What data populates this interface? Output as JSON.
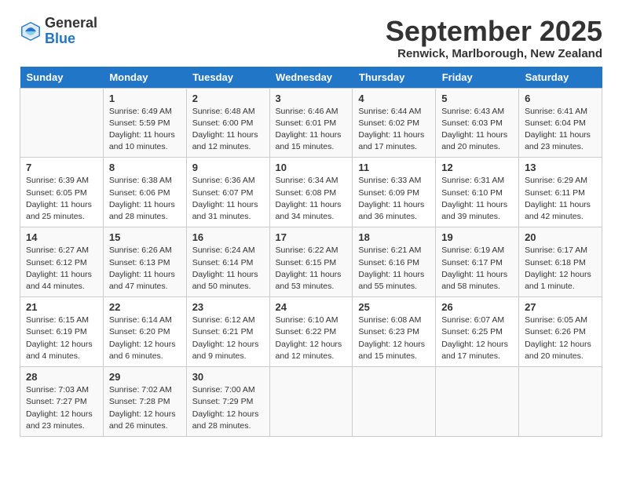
{
  "header": {
    "logo_general": "General",
    "logo_blue": "Blue",
    "month_year": "September 2025",
    "location": "Renwick, Marlborough, New Zealand"
  },
  "weekdays": [
    "Sunday",
    "Monday",
    "Tuesday",
    "Wednesday",
    "Thursday",
    "Friday",
    "Saturday"
  ],
  "weeks": [
    [
      {
        "day": "",
        "info": ""
      },
      {
        "day": "1",
        "info": "Sunrise: 6:49 AM\nSunset: 5:59 PM\nDaylight: 11 hours\nand 10 minutes."
      },
      {
        "day": "2",
        "info": "Sunrise: 6:48 AM\nSunset: 6:00 PM\nDaylight: 11 hours\nand 12 minutes."
      },
      {
        "day": "3",
        "info": "Sunrise: 6:46 AM\nSunset: 6:01 PM\nDaylight: 11 hours\nand 15 minutes."
      },
      {
        "day": "4",
        "info": "Sunrise: 6:44 AM\nSunset: 6:02 PM\nDaylight: 11 hours\nand 17 minutes."
      },
      {
        "day": "5",
        "info": "Sunrise: 6:43 AM\nSunset: 6:03 PM\nDaylight: 11 hours\nand 20 minutes."
      },
      {
        "day": "6",
        "info": "Sunrise: 6:41 AM\nSunset: 6:04 PM\nDaylight: 11 hours\nand 23 minutes."
      }
    ],
    [
      {
        "day": "7",
        "info": "Sunrise: 6:39 AM\nSunset: 6:05 PM\nDaylight: 11 hours\nand 25 minutes."
      },
      {
        "day": "8",
        "info": "Sunrise: 6:38 AM\nSunset: 6:06 PM\nDaylight: 11 hours\nand 28 minutes."
      },
      {
        "day": "9",
        "info": "Sunrise: 6:36 AM\nSunset: 6:07 PM\nDaylight: 11 hours\nand 31 minutes."
      },
      {
        "day": "10",
        "info": "Sunrise: 6:34 AM\nSunset: 6:08 PM\nDaylight: 11 hours\nand 34 minutes."
      },
      {
        "day": "11",
        "info": "Sunrise: 6:33 AM\nSunset: 6:09 PM\nDaylight: 11 hours\nand 36 minutes."
      },
      {
        "day": "12",
        "info": "Sunrise: 6:31 AM\nSunset: 6:10 PM\nDaylight: 11 hours\nand 39 minutes."
      },
      {
        "day": "13",
        "info": "Sunrise: 6:29 AM\nSunset: 6:11 PM\nDaylight: 11 hours\nand 42 minutes."
      }
    ],
    [
      {
        "day": "14",
        "info": "Sunrise: 6:27 AM\nSunset: 6:12 PM\nDaylight: 11 hours\nand 44 minutes."
      },
      {
        "day": "15",
        "info": "Sunrise: 6:26 AM\nSunset: 6:13 PM\nDaylight: 11 hours\nand 47 minutes."
      },
      {
        "day": "16",
        "info": "Sunrise: 6:24 AM\nSunset: 6:14 PM\nDaylight: 11 hours\nand 50 minutes."
      },
      {
        "day": "17",
        "info": "Sunrise: 6:22 AM\nSunset: 6:15 PM\nDaylight: 11 hours\nand 53 minutes."
      },
      {
        "day": "18",
        "info": "Sunrise: 6:21 AM\nSunset: 6:16 PM\nDaylight: 11 hours\nand 55 minutes."
      },
      {
        "day": "19",
        "info": "Sunrise: 6:19 AM\nSunset: 6:17 PM\nDaylight: 11 hours\nand 58 minutes."
      },
      {
        "day": "20",
        "info": "Sunrise: 6:17 AM\nSunset: 6:18 PM\nDaylight: 12 hours\nand 1 minute."
      }
    ],
    [
      {
        "day": "21",
        "info": "Sunrise: 6:15 AM\nSunset: 6:19 PM\nDaylight: 12 hours\nand 4 minutes."
      },
      {
        "day": "22",
        "info": "Sunrise: 6:14 AM\nSunset: 6:20 PM\nDaylight: 12 hours\nand 6 minutes."
      },
      {
        "day": "23",
        "info": "Sunrise: 6:12 AM\nSunset: 6:21 PM\nDaylight: 12 hours\nand 9 minutes."
      },
      {
        "day": "24",
        "info": "Sunrise: 6:10 AM\nSunset: 6:22 PM\nDaylight: 12 hours\nand 12 minutes."
      },
      {
        "day": "25",
        "info": "Sunrise: 6:08 AM\nSunset: 6:23 PM\nDaylight: 12 hours\nand 15 minutes."
      },
      {
        "day": "26",
        "info": "Sunrise: 6:07 AM\nSunset: 6:25 PM\nDaylight: 12 hours\nand 17 minutes."
      },
      {
        "day": "27",
        "info": "Sunrise: 6:05 AM\nSunset: 6:26 PM\nDaylight: 12 hours\nand 20 minutes."
      }
    ],
    [
      {
        "day": "28",
        "info": "Sunrise: 7:03 AM\nSunset: 7:27 PM\nDaylight: 12 hours\nand 23 minutes."
      },
      {
        "day": "29",
        "info": "Sunrise: 7:02 AM\nSunset: 7:28 PM\nDaylight: 12 hours\nand 26 minutes."
      },
      {
        "day": "30",
        "info": "Sunrise: 7:00 AM\nSunset: 7:29 PM\nDaylight: 12 hours\nand 28 minutes."
      },
      {
        "day": "",
        "info": ""
      },
      {
        "day": "",
        "info": ""
      },
      {
        "day": "",
        "info": ""
      },
      {
        "day": "",
        "info": ""
      }
    ]
  ]
}
